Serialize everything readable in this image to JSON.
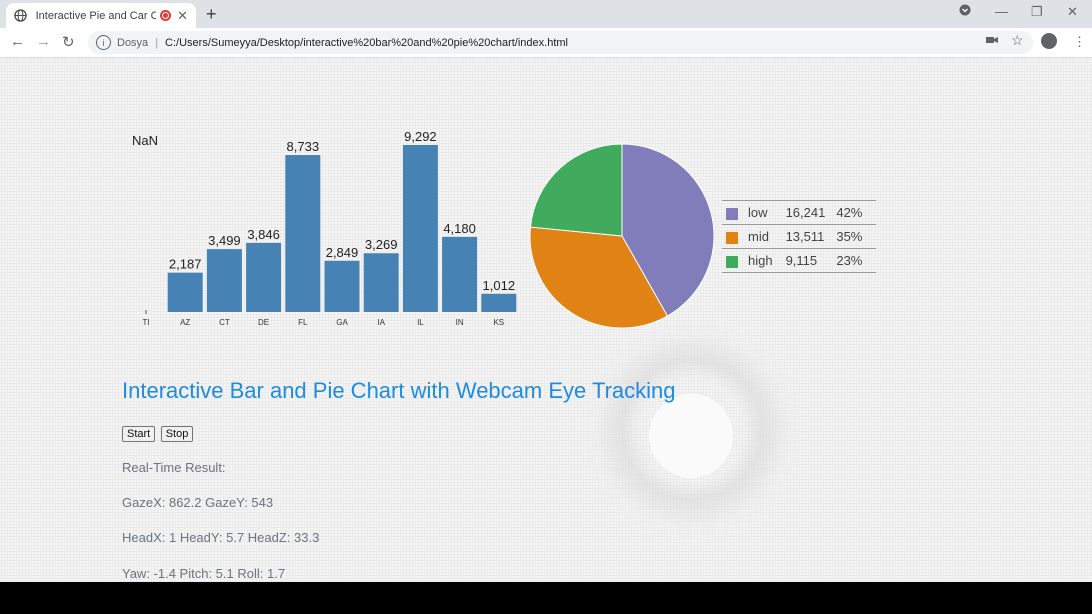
{
  "browser": {
    "tab_title": "Interactive Pie and Car Chart",
    "new_tab": "+",
    "site_label": "Dosya",
    "url": "C:/Users/Sumeyya/Desktop/interactive%20bar%20and%20pie%20chart/index.html",
    "icons": [
      "globe-icon",
      "recording-icon",
      "close-icon",
      "back-icon",
      "forward-icon",
      "reload-icon",
      "info-icon",
      "camera-icon",
      "star-icon",
      "profile-icon",
      "menu-icon"
    ]
  },
  "page": {
    "title": "Interactive Bar and Pie Chart with Webcam Eye Tracking",
    "start_label": "Start",
    "stop_label": "Stop",
    "realtime_label": "Real-Time Result:",
    "gaze_line": "GazeX: 862.2 GazeY: 543",
    "head_line": "HeadX: 1 HeadY: 5.7 HeadZ: 33.3",
    "orientation_line": "Yaw: -1.4 Pitch: 5.1 Roll: 1.7"
  },
  "chart_data": [
    {
      "type": "bar",
      "annotation": "NaN",
      "categories": [
        "TI",
        "AZ",
        "CT",
        "DE",
        "FL",
        "GA",
        "IA",
        "IL",
        "IN",
        "KS"
      ],
      "values": [
        null,
        2187,
        3499,
        3846,
        8733,
        2849,
        3269,
        9292,
        4180,
        1012
      ],
      "value_labels": [
        "",
        "2,187",
        "3,499",
        "3,846",
        "8,733",
        "2,849",
        "3,269",
        "9,292",
        "4,180",
        "1,012"
      ],
      "color": "#4682b4",
      "ylim": [
        0,
        9292
      ]
    },
    {
      "type": "pie",
      "slices": [
        {
          "name": "low",
          "value": 16241,
          "value_label": "16,241",
          "percent": "42%",
          "color": "#807dba"
        },
        {
          "name": "mid",
          "value": 13511,
          "value_label": "13,511",
          "percent": "35%",
          "color": "#e08214"
        },
        {
          "name": "high",
          "value": 9115,
          "value_label": "9,115",
          "percent": "23%",
          "color": "#41ab5d"
        }
      ],
      "legend_position": "right"
    }
  ]
}
